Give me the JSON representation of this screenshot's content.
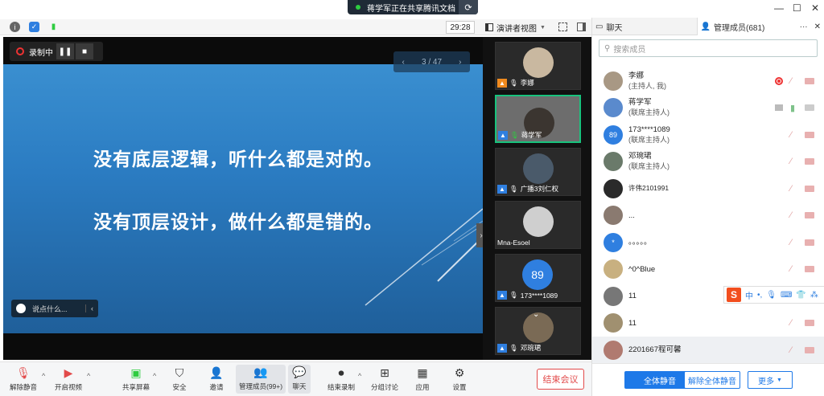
{
  "title_bar": {
    "share_notice": "蒋学军正在共享腾讯文档",
    "window_controls": [
      "—",
      "☐",
      "✕"
    ]
  },
  "top_toolbar": {
    "timer": "29:28",
    "view_label": "演讲者视图"
  },
  "stage": {
    "recording_label": "录制中",
    "page_indicator": "3 / 47",
    "slide_line1": "没有底层逻辑，听什么都是对的。",
    "slide_line2": "没有顶层设计，做什么都是错的。",
    "comment_placeholder": "说点什么..."
  },
  "thumbnails": [
    {
      "name": "李娜",
      "badge": "host"
    },
    {
      "name": "蒋学军",
      "badge": "cohost"
    },
    {
      "name": "广播3刘仁权",
      "badge": "user"
    },
    {
      "name": "Mna-Esoel",
      "badge": "none"
    },
    {
      "name": "173****1089",
      "avatar_text": "89",
      "badge": "user"
    },
    {
      "name": "邓琬珺",
      "badge": "user"
    }
  ],
  "bottom_toolbar": {
    "unmute": "解除静音",
    "start_video": "开启视频",
    "share_screen": "共享屏幕",
    "security": "安全",
    "invite": "邀请",
    "manage_members": "管理成员(99+)",
    "chat": "聊天",
    "end_recording": "结束录制",
    "breakout": "分组讨论",
    "apps": "应用",
    "settings": "设置",
    "end_meeting": "结束会议"
  },
  "right_panel": {
    "tab_chat": "聊天",
    "tab_members": "管理成员(681)",
    "search_placeholder": "搜索成员",
    "members": [
      {
        "name": "李娜",
        "role": "(主持人, 我)",
        "avatar": "",
        "status": "recording"
      },
      {
        "name": "蒋学军",
        "role": "(联席主持人)",
        "avatar": "",
        "status": "sharing"
      },
      {
        "name": "173****1089",
        "role": "(联席主持人)",
        "avatar": "89",
        "status": "muted"
      },
      {
        "name": "邓琬珺",
        "role": "(联席主持人)",
        "avatar": "",
        "status": "muted"
      },
      {
        "name": "许伟2101991",
        "role": "",
        "avatar": "",
        "status": "muted"
      },
      {
        "name": "...",
        "role": "",
        "avatar": "",
        "status": "muted"
      },
      {
        "name": "。。。。。",
        "role": "",
        "avatar": "*",
        "status": "muted"
      },
      {
        "name": "^0^Blue",
        "role": "",
        "avatar": "",
        "status": "muted"
      },
      {
        "name": "11",
        "role": "",
        "avatar": "",
        "status": "muted"
      },
      {
        "name": "11",
        "role": "",
        "avatar": "",
        "status": "muted"
      },
      {
        "name": "2201667程可馨",
        "role": "",
        "avatar": "",
        "status": "muted"
      }
    ],
    "ime_label": "中",
    "footer": {
      "mute_all": "全体静音",
      "unmute_all": "解除全体静音",
      "more": "更多"
    }
  },
  "colors": {
    "accent": "#1e79e8",
    "danger": "#e24a4a",
    "active_green": "#18c37d"
  }
}
